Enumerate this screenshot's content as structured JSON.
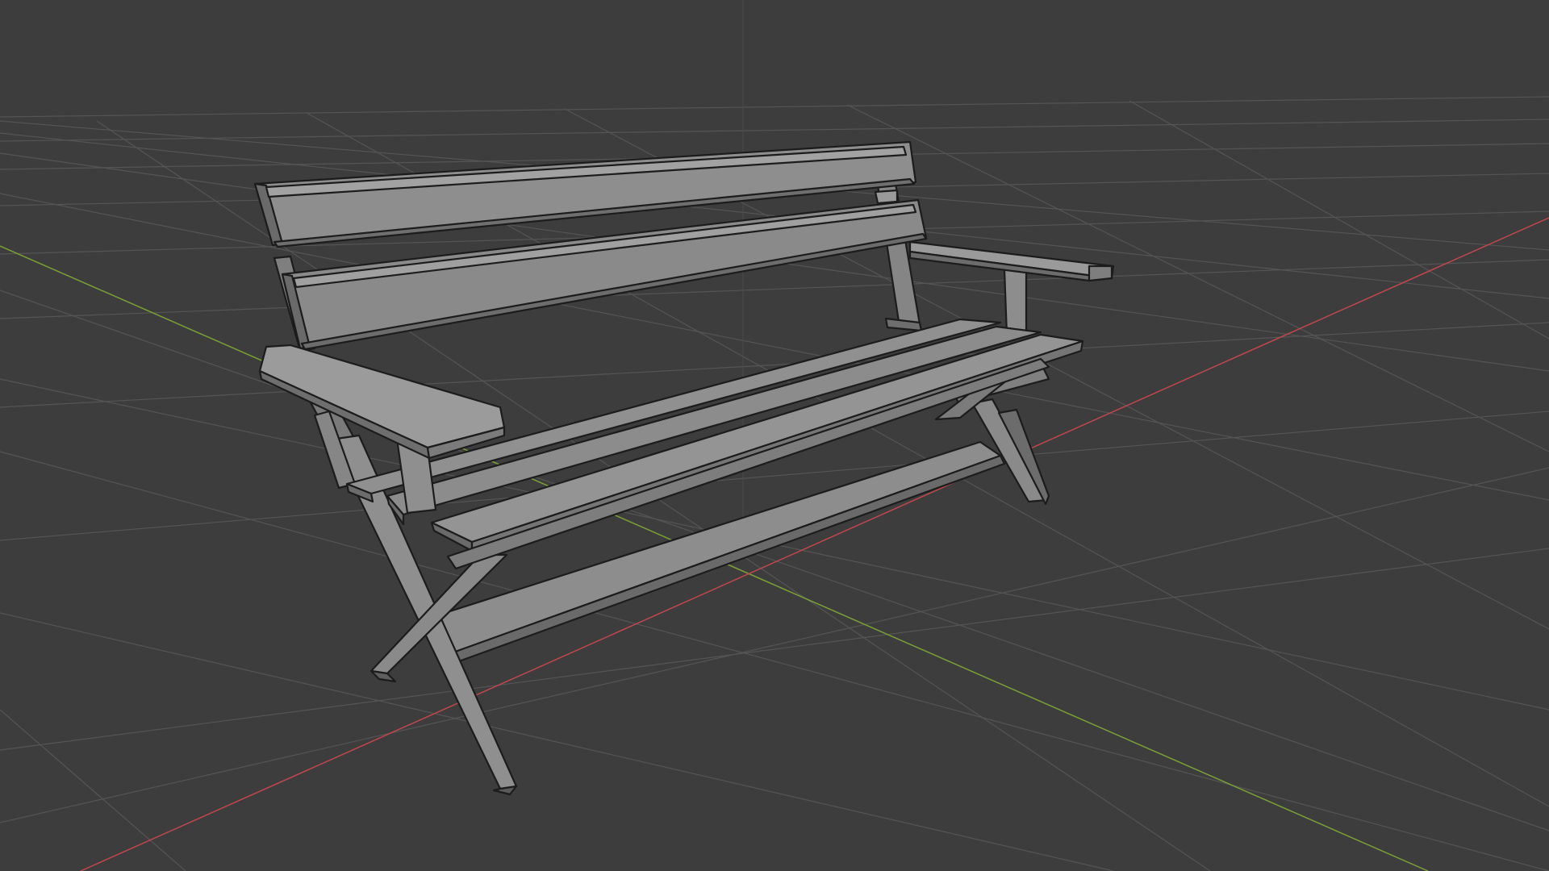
{
  "app": "3D viewport",
  "scene": {
    "object": "bench",
    "parts": [
      "backrest-upper-slat",
      "backrest-lower-slat",
      "seat-slats",
      "left-armrest",
      "right-armrest",
      "x-leg-front",
      "x-leg-back",
      "stretcher"
    ]
  },
  "viewport": {
    "shading": "solid",
    "overlays": {
      "floor_grid": true,
      "x_axis_line": true,
      "y_axis_line": true,
      "wireframe_edges": true
    }
  },
  "colors": {
    "background": "#3d3d3d",
    "grid": "#555555",
    "x_axis": "#c0474f",
    "y_axis": "#7aa136",
    "mesh_face": "#8b8b8b",
    "mesh_edge": "#1e1e1e"
  }
}
